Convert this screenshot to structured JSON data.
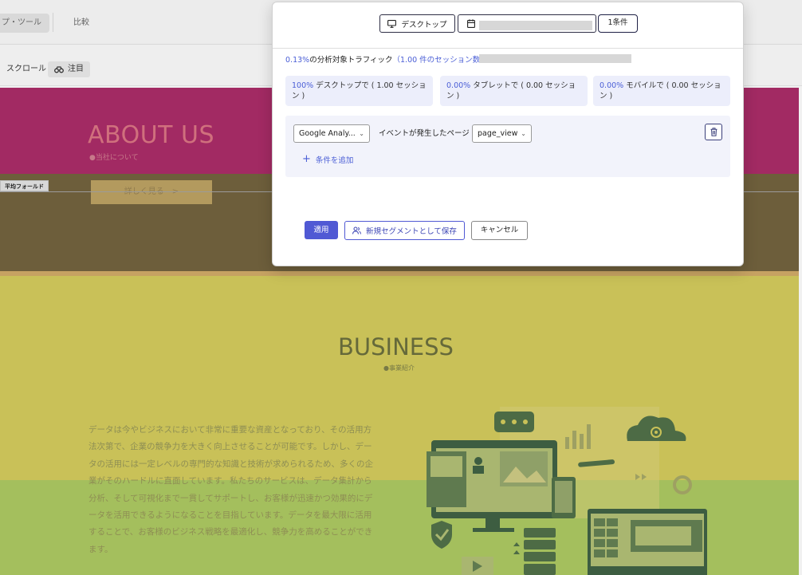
{
  "app": {
    "tabs": {
      "heatmap_label": "プ・ツール",
      "compare_label": "比較"
    },
    "modes": {
      "scroll_label": "スクロール",
      "attention_label": "注目"
    }
  },
  "preview": {
    "about_title": "ABOUT US",
    "about_sub": "●当社について",
    "more_button": "詳しく見る　>",
    "fold_label": "平均フォールド",
    "business_title": "BUSINESS",
    "business_sub": "●事業紹介",
    "business_text": "データは今やビジネスにおいて非常に重要な資産となっており、その活用方法次第で、企業の競争力を大きく向上させることが可能です。しかし、データの活用には一定レベルの専門的な知識と技術が求められるため、多くの企業がそのハードルに直面しています。私たちのサービスは、データ集計から分析、そして可視化まで一貫してサポートし、お客様が迅速かつ効果的にデータを活用できるようになることを目指しています。データを最大限に活用することで、お客様のビジネス戦略を最適化し、競争力を高めることができます。"
  },
  "modal": {
    "device_label": "デスクトップ",
    "condition_count": "1条件",
    "traffic": {
      "pct": "0.13%",
      "text": "の分析対象トラフィック",
      "sessions": "（1.00 件のセッション数）"
    },
    "stats": [
      {
        "pct": "100%",
        "text": " デスクトップで ( 1.00 セッション )"
      },
      {
        "pct": "0.00%",
        "text": " タブレットで ( 0.00 セッション )"
      },
      {
        "pct": "0.00%",
        "text": " モバイルで ( 0.00 セッション )"
      }
    ],
    "condition": {
      "source": "Google Analy...",
      "label": "イベントが発生したページ",
      "event": "page_view",
      "add_label": "条件を追加"
    },
    "buttons": {
      "apply": "適用",
      "save_segment": "新規セグメントとして保存",
      "cancel": "キャンセル"
    }
  },
  "colors": {
    "accent": "#5059d4",
    "heat_red": "#a22a63",
    "heat_olive": "#6d5e3b",
    "heat_yellow": "#c9c158",
    "heat_green": "#a4bf5d"
  }
}
